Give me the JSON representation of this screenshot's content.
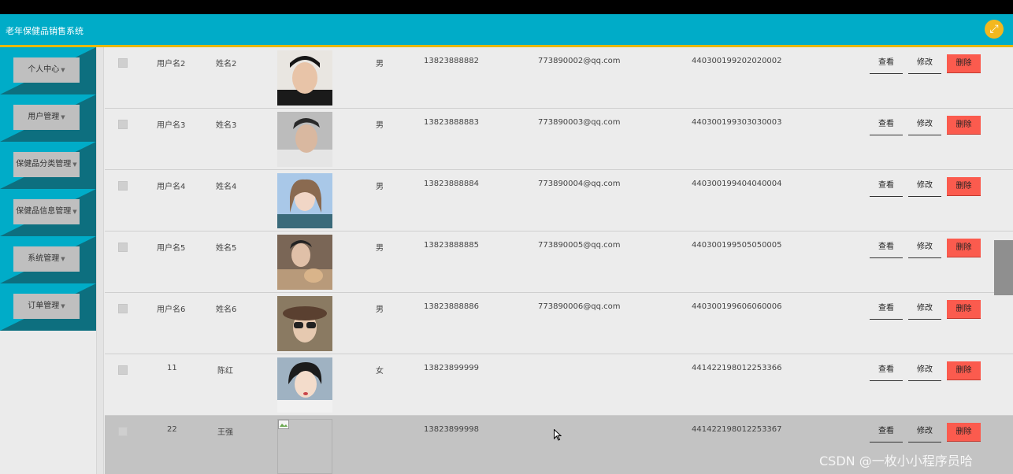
{
  "app": {
    "title": "老年保健品销售系统"
  },
  "sidebar": {
    "items": [
      {
        "label": "个人中心"
      },
      {
        "label": "用户管理"
      },
      {
        "label": "保健品分类管理"
      },
      {
        "label": "保健品信息管理"
      },
      {
        "label": "系统管理"
      },
      {
        "label": "订单管理"
      }
    ]
  },
  "actions": {
    "view": "查看",
    "edit": "修改",
    "delete": "删除"
  },
  "rows": [
    {
      "username": "用户名2",
      "name": "姓名2",
      "gender": "男",
      "phone": "13823888882",
      "email": "773890002@qq.com",
      "idcard": "440300199202020002"
    },
    {
      "username": "用户名3",
      "name": "姓名3",
      "gender": "男",
      "phone": "13823888883",
      "email": "773890003@qq.com",
      "idcard": "440300199303030003"
    },
    {
      "username": "用户名4",
      "name": "姓名4",
      "gender": "男",
      "phone": "13823888884",
      "email": "773890004@qq.com",
      "idcard": "440300199404040004"
    },
    {
      "username": "用户名5",
      "name": "姓名5",
      "gender": "男",
      "phone": "13823888885",
      "email": "773890005@qq.com",
      "idcard": "440300199505050005"
    },
    {
      "username": "用户名6",
      "name": "姓名6",
      "gender": "男",
      "phone": "13823888886",
      "email": "773890006@qq.com",
      "idcard": "440300199606060006"
    },
    {
      "username": "11",
      "name": "陈红",
      "gender": "女",
      "phone": "13823899999",
      "email": "",
      "idcard": "441422198012253366"
    },
    {
      "username": "22",
      "name": "王强",
      "gender": "",
      "phone": "13823899998",
      "email": "",
      "idcard": "441422198012253367"
    }
  ],
  "watermark": "CSDN @一枚小小程序员哈",
  "colors": {
    "header": "#00acc8",
    "accent_line": "#e6b800",
    "delete": "#fb5b4e",
    "sidebar_dark": "#0d6f7f"
  }
}
